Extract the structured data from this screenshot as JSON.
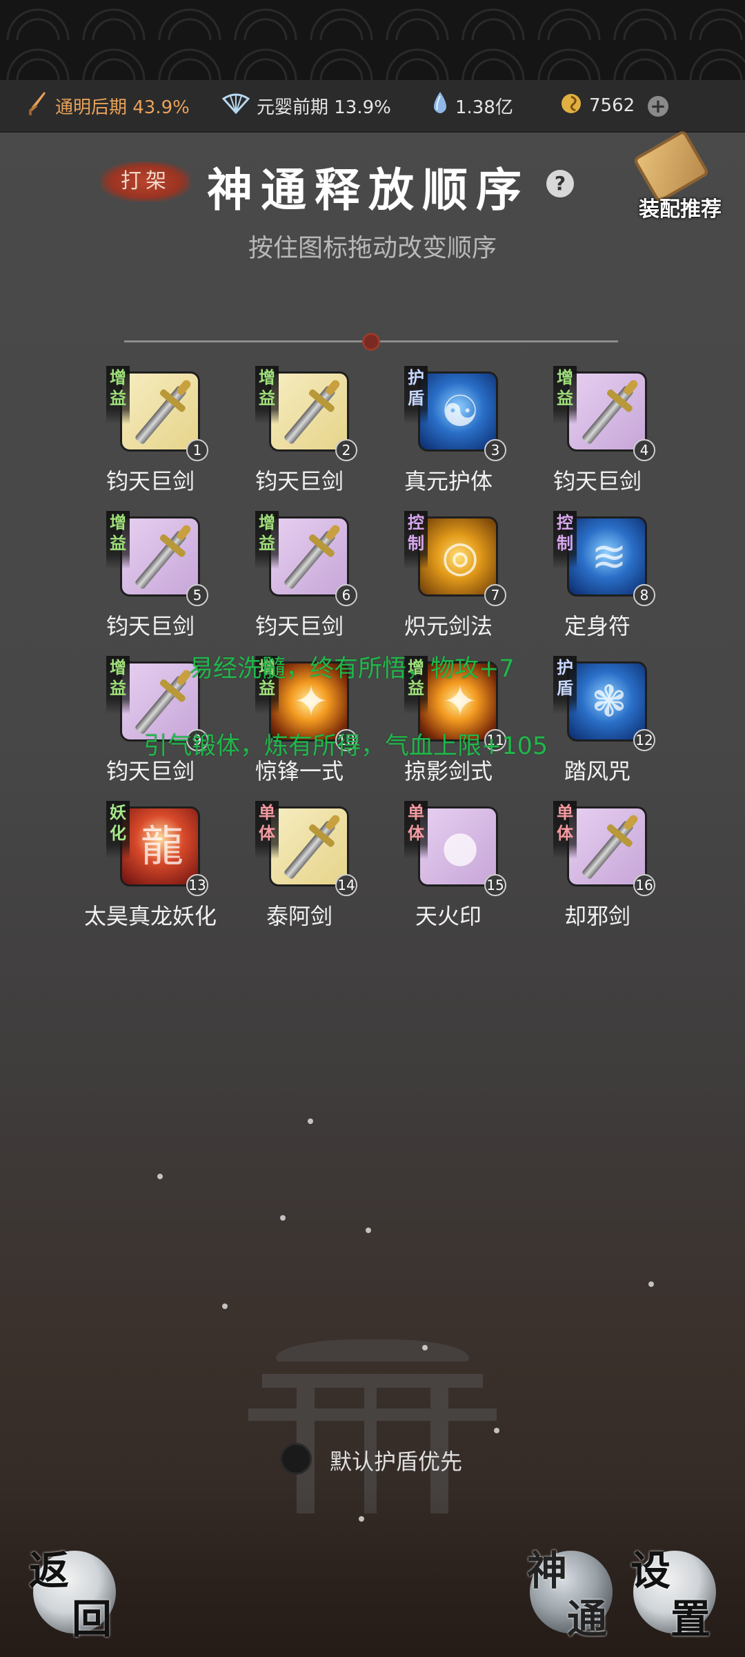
{
  "status": {
    "realm_primary": "通明后期 43.9%",
    "realm_secondary": "元婴前期 13.9%",
    "spirit_stones": "1.38亿",
    "coins": "7562",
    "add_label": "+",
    "colors": {
      "realm_primary": "#e9a25a"
    }
  },
  "header": {
    "mode_badge": "打架",
    "title": "神通释放顺序",
    "help_label": "?",
    "recommend_label": "装配推荐",
    "subtitle": "按住图标拖动改变顺序"
  },
  "skills": [
    {
      "order": "1",
      "tag": "增益",
      "name": "钧天巨剑",
      "icon": "golden-sword-icon",
      "bg": "yellow"
    },
    {
      "order": "2",
      "tag": "增益",
      "name": "钧天巨剑",
      "icon": "golden-sword-icon",
      "bg": "yellow"
    },
    {
      "order": "3",
      "tag": "护盾",
      "name": "真元护体",
      "icon": "blue-aura-body-icon",
      "bg": "blue"
    },
    {
      "order": "4",
      "tag": "增益",
      "name": "钧天巨剑",
      "icon": "golden-sword-icon",
      "bg": "purple"
    },
    {
      "order": "5",
      "tag": "增益",
      "name": "钧天巨剑",
      "icon": "golden-sword-icon",
      "bg": "purple"
    },
    {
      "order": "6",
      "tag": "增益",
      "name": "钧天巨剑",
      "icon": "golden-sword-icon",
      "bg": "purple"
    },
    {
      "order": "7",
      "tag": "控制",
      "name": "炽元剑法",
      "icon": "golden-bell-icon",
      "bg": "gold"
    },
    {
      "order": "8",
      "tag": "控制",
      "name": "定身符",
      "icon": "blue-talisman-icon",
      "bg": "blue"
    },
    {
      "order": "9",
      "tag": "增益",
      "name": "钧天巨剑",
      "icon": "golden-sword-icon",
      "bg": "purple"
    },
    {
      "order": "10",
      "tag": "增益",
      "name": "惊锋一式",
      "icon": "fire-glyph-icon",
      "bg": "fire"
    },
    {
      "order": "11",
      "tag": "增益",
      "name": "掠影剑式",
      "icon": "fire-glyph-icon",
      "bg": "fire"
    },
    {
      "order": "12",
      "tag": "护盾",
      "name": "踏风咒",
      "icon": "wind-swirl-icon",
      "bg": "blue"
    },
    {
      "order": "13",
      "tag": "妖化",
      "name": "太昊真龙妖化",
      "icon": "dragon-head-icon",
      "bg": "red"
    },
    {
      "order": "14",
      "tag": "单体",
      "name": "泰阿剑",
      "icon": "bronze-sword-icon",
      "bg": "yellow"
    },
    {
      "order": "15",
      "tag": "单体",
      "name": "天火印",
      "icon": "red-seal-icon",
      "bg": "purple"
    },
    {
      "order": "16",
      "tag": "单体",
      "name": "却邪剑",
      "icon": "silver-sword-icon",
      "bg": "purple"
    }
  ],
  "floating_messages": [
    "易经洗髓，终有所悟，物攻+7",
    "引气锻体，炼有所得，气血上限+105"
  ],
  "options": {
    "shield_priority_label": "默认护盾优先",
    "shield_priority_checked": false
  },
  "footer": {
    "back_label_1": "返",
    "back_label_2": "回",
    "skills_label_1": "神",
    "skills_label_2": "通",
    "settings_label_1": "设",
    "settings_label_2": "置"
  }
}
